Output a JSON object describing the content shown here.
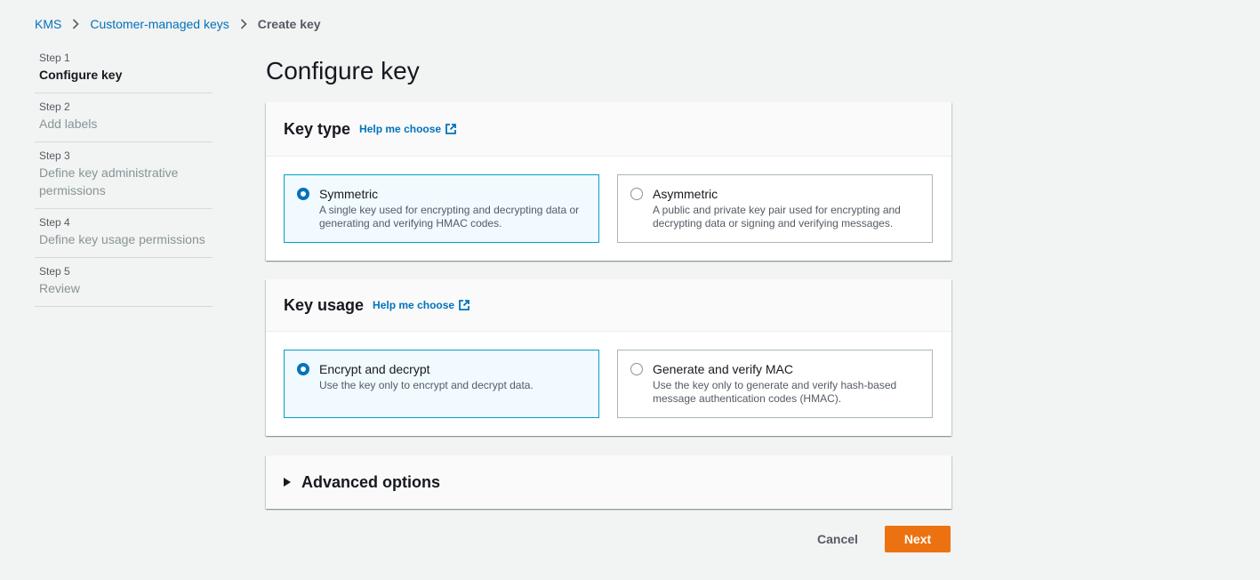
{
  "breadcrumb": {
    "items": [
      "KMS",
      "Customer-managed keys"
    ],
    "current": "Create key"
  },
  "steps": [
    {
      "num": "Step 1",
      "title": "Configure key",
      "active": true
    },
    {
      "num": "Step 2",
      "title": "Add labels",
      "active": false
    },
    {
      "num": "Step 3",
      "title": "Define key administrative permissions",
      "active": false
    },
    {
      "num": "Step 4",
      "title": "Define key usage permissions",
      "active": false
    },
    {
      "num": "Step 5",
      "title": "Review",
      "active": false
    }
  ],
  "page_title": "Configure key",
  "key_type": {
    "title": "Key type",
    "help": "Help me choose",
    "options": [
      {
        "label": "Symmetric",
        "desc": "A single key used for encrypting and decrypting data or generating and verifying HMAC codes.",
        "selected": true
      },
      {
        "label": "Asymmetric",
        "desc": "A public and private key pair used for encrypting and decrypting data or signing and verifying messages.",
        "selected": false
      }
    ]
  },
  "key_usage": {
    "title": "Key usage",
    "help": "Help me choose",
    "options": [
      {
        "label": "Encrypt and decrypt",
        "desc": "Use the key only to encrypt and decrypt data.",
        "selected": true
      },
      {
        "label": "Generate and verify MAC",
        "desc": "Use the key only to generate and verify hash-based message authentication codes (HMAC).",
        "selected": false
      }
    ]
  },
  "advanced": {
    "title": "Advanced options",
    "expanded": false
  },
  "actions": {
    "cancel": "Cancel",
    "next": "Next"
  },
  "colors": {
    "link": "#0073bb",
    "primary_button": "#ec7211",
    "selected_border": "#00a1c9",
    "selected_bg": "#f1faff"
  },
  "icons": {
    "breadcrumb_separator": "chevron-right-icon",
    "help_external": "external-link-icon",
    "advanced_toggle": "caret-right-icon"
  }
}
